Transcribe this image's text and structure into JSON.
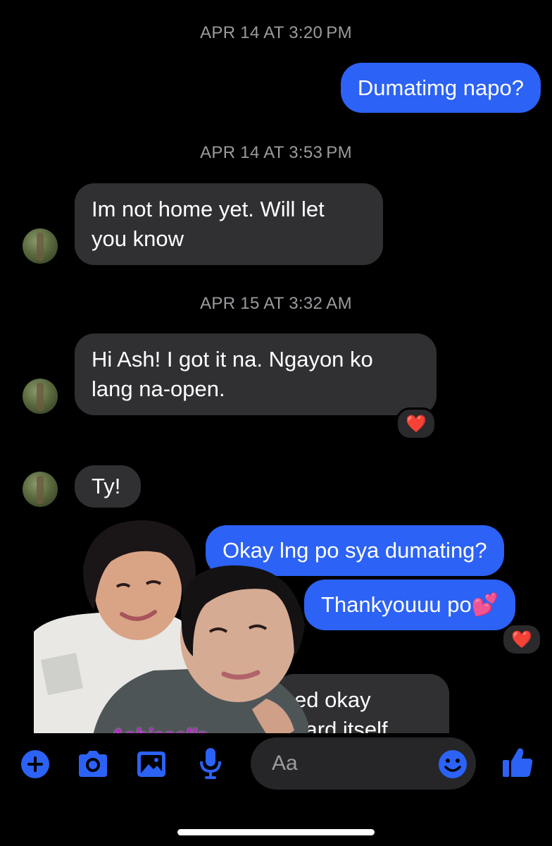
{
  "messages": {
    "ts1": "APR 14 AT 3:20 PM",
    "out1": "Dumatimg napo?",
    "ts2": "APR 14 AT 3:53 PM",
    "in1_line1": "Im not home yet. Will let",
    "in1_line2": "you know",
    "ts3": "APR 15 AT 3:32 AM",
    "in2_line1": "Hi Ash! I got it na. Ngayon ko",
    "in2_line2": "lang na-open.",
    "in3": "Ty!",
    "out2": "Okay lng po sya dumating?",
    "out3": "Thankyouuu po",
    "out3_emoji": "💕",
    "in4_partial_line1": "ed okay",
    "in4_partial_line2": "card itself"
  },
  "reactions": {
    "heart": "❤️"
  },
  "sticker": {
    "watermark": "Ashiesells"
  },
  "composer": {
    "placeholder": "Aa"
  },
  "colors": {
    "accent": "#2c62f5",
    "incoming_bubble": "#303033",
    "background": "#000000",
    "timestamp": "#9b9ba0",
    "reaction_heart": "#e4162f"
  },
  "icons": [
    "plus-icon",
    "camera-icon",
    "image-icon",
    "microphone-icon",
    "emoji-icon",
    "thumbs-up-icon"
  ]
}
